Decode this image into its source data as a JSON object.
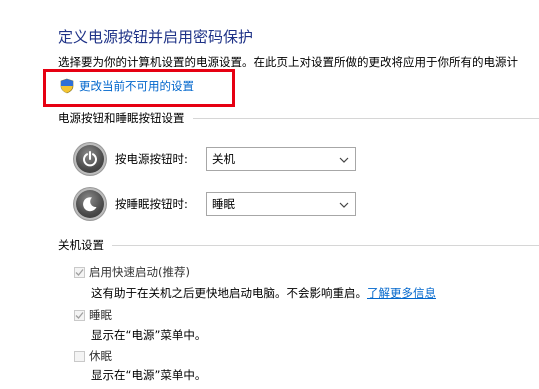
{
  "header": {
    "title": "定义电源按钮并启用密码保护",
    "subtitle": "选择要为你的计算机设置的电源设置。在此页上对设置所做的更改将应用于你所有的电源计",
    "change_link": "更改当前不可用的设置",
    "change_link_icon": "uac-shield-icon"
  },
  "power_section": {
    "title": "电源按钮和睡眠按钮设置",
    "power_button": {
      "label": "按电源按钮时:",
      "value": "关机",
      "icon": "power-button-icon"
    },
    "sleep_button": {
      "label": "按睡眠按钮时:",
      "value": "睡眠",
      "icon": "sleep-button-icon"
    }
  },
  "shutdown_section": {
    "title": "关机设置",
    "items": [
      {
        "label": "启用快速启动(推荐)",
        "checked": true,
        "disabled": true,
        "description": "这有助于在关机之后更快地启动电脑。不会影响重启。",
        "link": "了解更多信息"
      },
      {
        "label": "睡眠",
        "checked": true,
        "disabled": true,
        "description": "显示在“电源”菜单中。"
      },
      {
        "label": "休眠",
        "checked": false,
        "disabled": true,
        "description": "显示在“电源”菜单中。"
      }
    ]
  },
  "colors": {
    "title": "#1e3287",
    "link": "#0066cc",
    "highlight": "#e60012"
  }
}
